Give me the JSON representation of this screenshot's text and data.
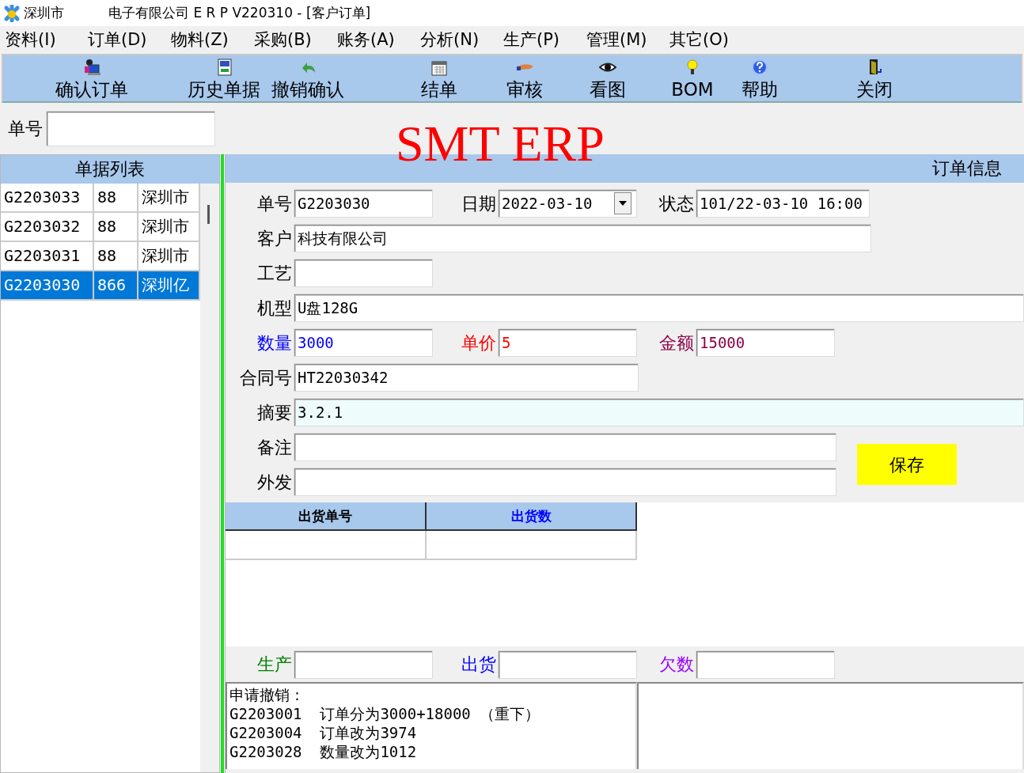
{
  "window": {
    "title_prefix": "深圳市",
    "title": "电子有限公司 E R P V220310 - [客户订单]"
  },
  "menu": [
    "资料(I)",
    "订单(D)",
    "物料(Z)",
    "采购(B)",
    "账务(A)",
    "分析(N)",
    "生产(P)",
    "管理(M)",
    "其它(O)"
  ],
  "toolbar": [
    {
      "label": "确认订单"
    },
    {
      "label": "历史单据"
    },
    {
      "label": "撤销确认"
    },
    {
      "label": "结单"
    },
    {
      "label": "审核"
    },
    {
      "label": "看图"
    },
    {
      "label": "BOM"
    },
    {
      "label": "帮助"
    },
    {
      "label": "关闭"
    }
  ],
  "search": {
    "label": "单号"
  },
  "banner": "SMT ERP",
  "order_list": {
    "title": "单据列表",
    "rows": [
      {
        "cells": [
          "G2203033",
          "88",
          "深圳市"
        ],
        "selected": false
      },
      {
        "cells": [
          "G2203032",
          "88",
          "深圳市"
        ],
        "selected": false
      },
      {
        "cells": [
          "G2203031",
          "88",
          "深圳市"
        ],
        "selected": false
      },
      {
        "cells": [
          "G2203030",
          "866",
          "深圳亿"
        ],
        "selected": true
      }
    ]
  },
  "order_info": {
    "title": "订单信息",
    "fields": [
      {
        "label": "单号",
        "value": "G2203030",
        "kind": "text",
        "color": "#000000",
        "focused": false
      },
      {
        "label": "日期",
        "value": "2022-03-10",
        "kind": "dropdown",
        "color": "#000000",
        "focused": false
      },
      {
        "label": "状态",
        "value": "101/22-03-10 16:00",
        "kind": "text",
        "color": "#000000",
        "focused": false
      },
      {
        "label": "客户",
        "value": "科技有限公司",
        "kind": "text",
        "color": "#000000",
        "focused": false
      },
      {
        "label": "工艺",
        "kind": "text",
        "color": "#000000",
        "focused": false
      },
      {
        "label": "机型",
        "value": "U盘128G",
        "kind": "text",
        "color": "#000000",
        "focused": false
      },
      {
        "label": "数量",
        "value": "3000",
        "kind": "text",
        "color": "#0000ff",
        "focused": false
      },
      {
        "label": "单价",
        "value": "5",
        "kind": "text",
        "color": "#ff0000",
        "focused": false
      },
      {
        "label": "金额",
        "value": "15000",
        "kind": "text",
        "color": "#8b0046",
        "focused": false
      },
      {
        "label": "合同号",
        "value": "HT22030342",
        "kind": "text",
        "color": "#000000",
        "focused": false
      },
      {
        "label": "摘要",
        "value": "3.2.1",
        "kind": "text",
        "color": "#000000",
        "focused": true
      },
      {
        "label": "备注",
        "kind": "text",
        "color": "#000000",
        "focused": false
      },
      {
        "label": "外发",
        "kind": "text",
        "color": "#000000",
        "focused": false
      }
    ],
    "save_button": "保存"
  },
  "shipments": {
    "columns": [
      {
        "label": "出货单号",
        "color": "#000000"
      },
      {
        "label": "出货数",
        "color": "#0000ff"
      }
    ]
  },
  "totals": [
    {
      "label": "生产",
      "color": "#008000"
    },
    {
      "label": "出货",
      "color": "#0000ff"
    },
    {
      "label": "欠数",
      "color": "#9900ff"
    }
  ],
  "notes": {
    "lines": [
      "申请撤销：",
      "G2203001  订单分为3000+18000 （重下）",
      "G2203004  订单改为3974",
      "G2203028  数量改为1012"
    ]
  }
}
